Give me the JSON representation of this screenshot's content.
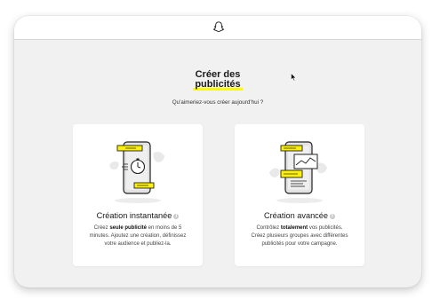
{
  "header": {
    "logo_icon": "snapchat-ghost-icon"
  },
  "main": {
    "title_line1": "Créer des",
    "title_line2": "publicités",
    "subtitle": "Qu'aimeriez-vous créer aujourd'hui ?"
  },
  "cards": [
    {
      "title": "Création instantanée",
      "info_icon": "info-icon",
      "desc_before": "Créez ",
      "desc_bold": "seule publicité",
      "desc_after": " en moins de 5 minutes. Ajoutez une création, définissez votre audience et publiez-la.",
      "illustration_icon": "phone-stopwatch-icon"
    },
    {
      "title": "Création avancée",
      "info_icon": "info-icon",
      "desc_before": "Contrôlez ",
      "desc_bold": "totalement",
      "desc_after": " vos publicités. Créez plusieurs groupes avec différentes publicités pour votre campagne.",
      "illustration_icon": "phone-ads-chart-icon"
    }
  ],
  "colors": {
    "accent": "#fffc00",
    "background": "#f1f1f1",
    "card": "#ffffff"
  }
}
